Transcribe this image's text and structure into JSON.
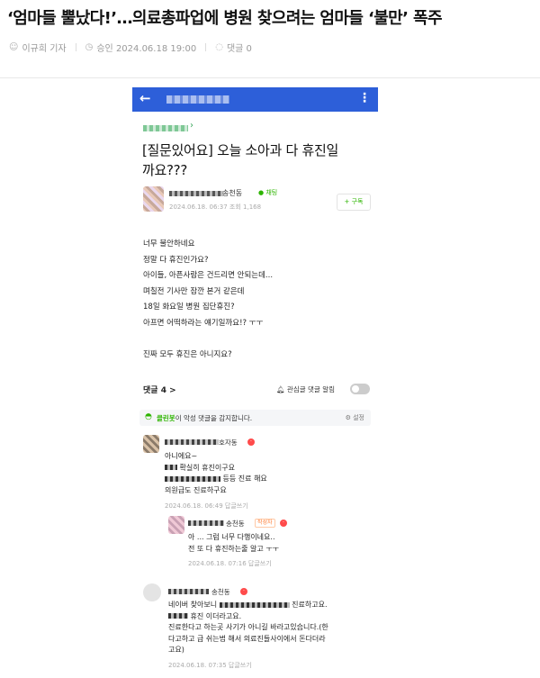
{
  "article": {
    "headline": "‘엄마들 뿔났다!’…의료총파업에 병원 찾으려는 엄마들 ‘불만’ 폭주",
    "author": "이규희 기자",
    "approved": "승인 2024.06.18 19:00",
    "comments": "댓글 0"
  },
  "app": {
    "back_icon": "back-arrow-icon",
    "menu_icon": "more-vertical-icon",
    "brand_color": "#2d5fd9"
  },
  "post": {
    "title_line1": "[질문있어요] 오늘 소아과 다 휴진일",
    "title_line2": "까요???",
    "author_suffix": "송천동",
    "grade": "채팅",
    "info": "2024.06.18. 06:37 조회 1,168",
    "follow": "+ 구독",
    "body": "너무 불안하네요\n정말 다 휴진인가요?\n아이들, 아픈사람은 건드리면 안되는데...\n며칠전 기사만 잠깐 본거 같은데\n18일 화요일 병원 집단휴진?\n아프면 어떡하라는 얘기일까요!? ㅜㅜ\n\n진짜 모두 휴진은 아니지요?"
  },
  "comments_bar": {
    "count": "댓글 4 >",
    "alert": "관심글 댓글 알림"
  },
  "cleanbot": {
    "name": "클린봇",
    "text": "이 악성 댓글을 감지합니다.",
    "settings": "설정"
  },
  "comments": [
    {
      "name_suffix": "호자동",
      "line1": "아니에요~",
      "line2a": "확실히 휴진이구요",
      "line3b": "등등 진료 해요",
      "line4": "의원급도 진료하구요",
      "meta": "2024.06.18. 06:49    답글쓰기"
    },
    {
      "name_suffix": "송천동",
      "badge": "작성자",
      "line1": "아 ... 그럼 너무 다행이네요..",
      "line2": "전 또 다 휴진하는줄 알고 ㅜㅜ",
      "meta": "2024.06.18. 07:16    답글쓰기"
    },
    {
      "name_suffix": "송천동",
      "line1a": "네이버 찾아보니",
      "line1b": "진료하고요.",
      "line2": "휴진 이더라고요.",
      "line3": "진료한다고 하는곳 사기가 아니길 바라고있습니다.(한",
      "line4": "다고하고 급 쉬는법 해서 의료진들사이에서 돈다더라",
      "line5": "고요)",
      "meta": "2024.06.18. 07:35    답글쓰기"
    }
  ]
}
